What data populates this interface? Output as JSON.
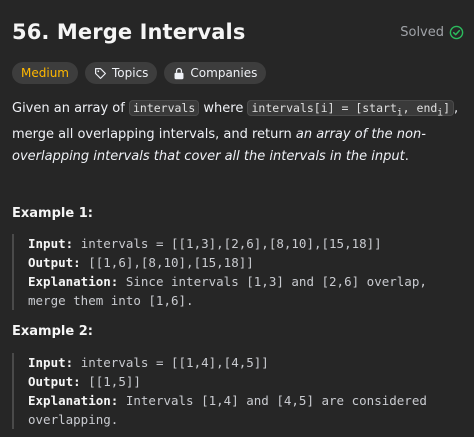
{
  "problem": {
    "title": "56. Merge Intervals",
    "status": "Solved",
    "status_color": "#a0a3a8",
    "status_icon": "check-circle-icon"
  },
  "tags": {
    "difficulty": "Medium",
    "difficulty_color": "#ffb800",
    "topics": "Topics",
    "companies": "Companies"
  },
  "description": {
    "p1": "Given an array of ",
    "code1": "intervals",
    "p2": " where ",
    "code2": "intervals[i] = [start",
    "sub1": "i",
    "code2b": ", end",
    "sub2": "i",
    "code2c": "]",
    "p3": ", merge all overlapping intervals, and return ",
    "em": "an array of the non-overlapping intervals that cover all the intervals in the input",
    "p4": "."
  },
  "examples": [
    {
      "title": "Example 1:",
      "input_label": "Input:",
      "input": "intervals = [[1,3],[2,6],[8,10],[15,18]]",
      "output_label": "Output:",
      "output": "[[1,6],[8,10],[15,18]]",
      "explanation_label": "Explanation:",
      "explanation_1": "Since intervals [1,3] and [2,6] overlap,",
      "explanation_2": "merge them into [1,6]."
    },
    {
      "title": "Example 2:",
      "input_label": "Input:",
      "input": "intervals = [[1,4],[4,5]]",
      "output_label": "Output:",
      "output": "[[1,5]]",
      "explanation_label": "Explanation:",
      "explanation_1": "Intervals [1,4] and [4,5] are considered",
      "explanation_2": "overlapping."
    }
  ]
}
